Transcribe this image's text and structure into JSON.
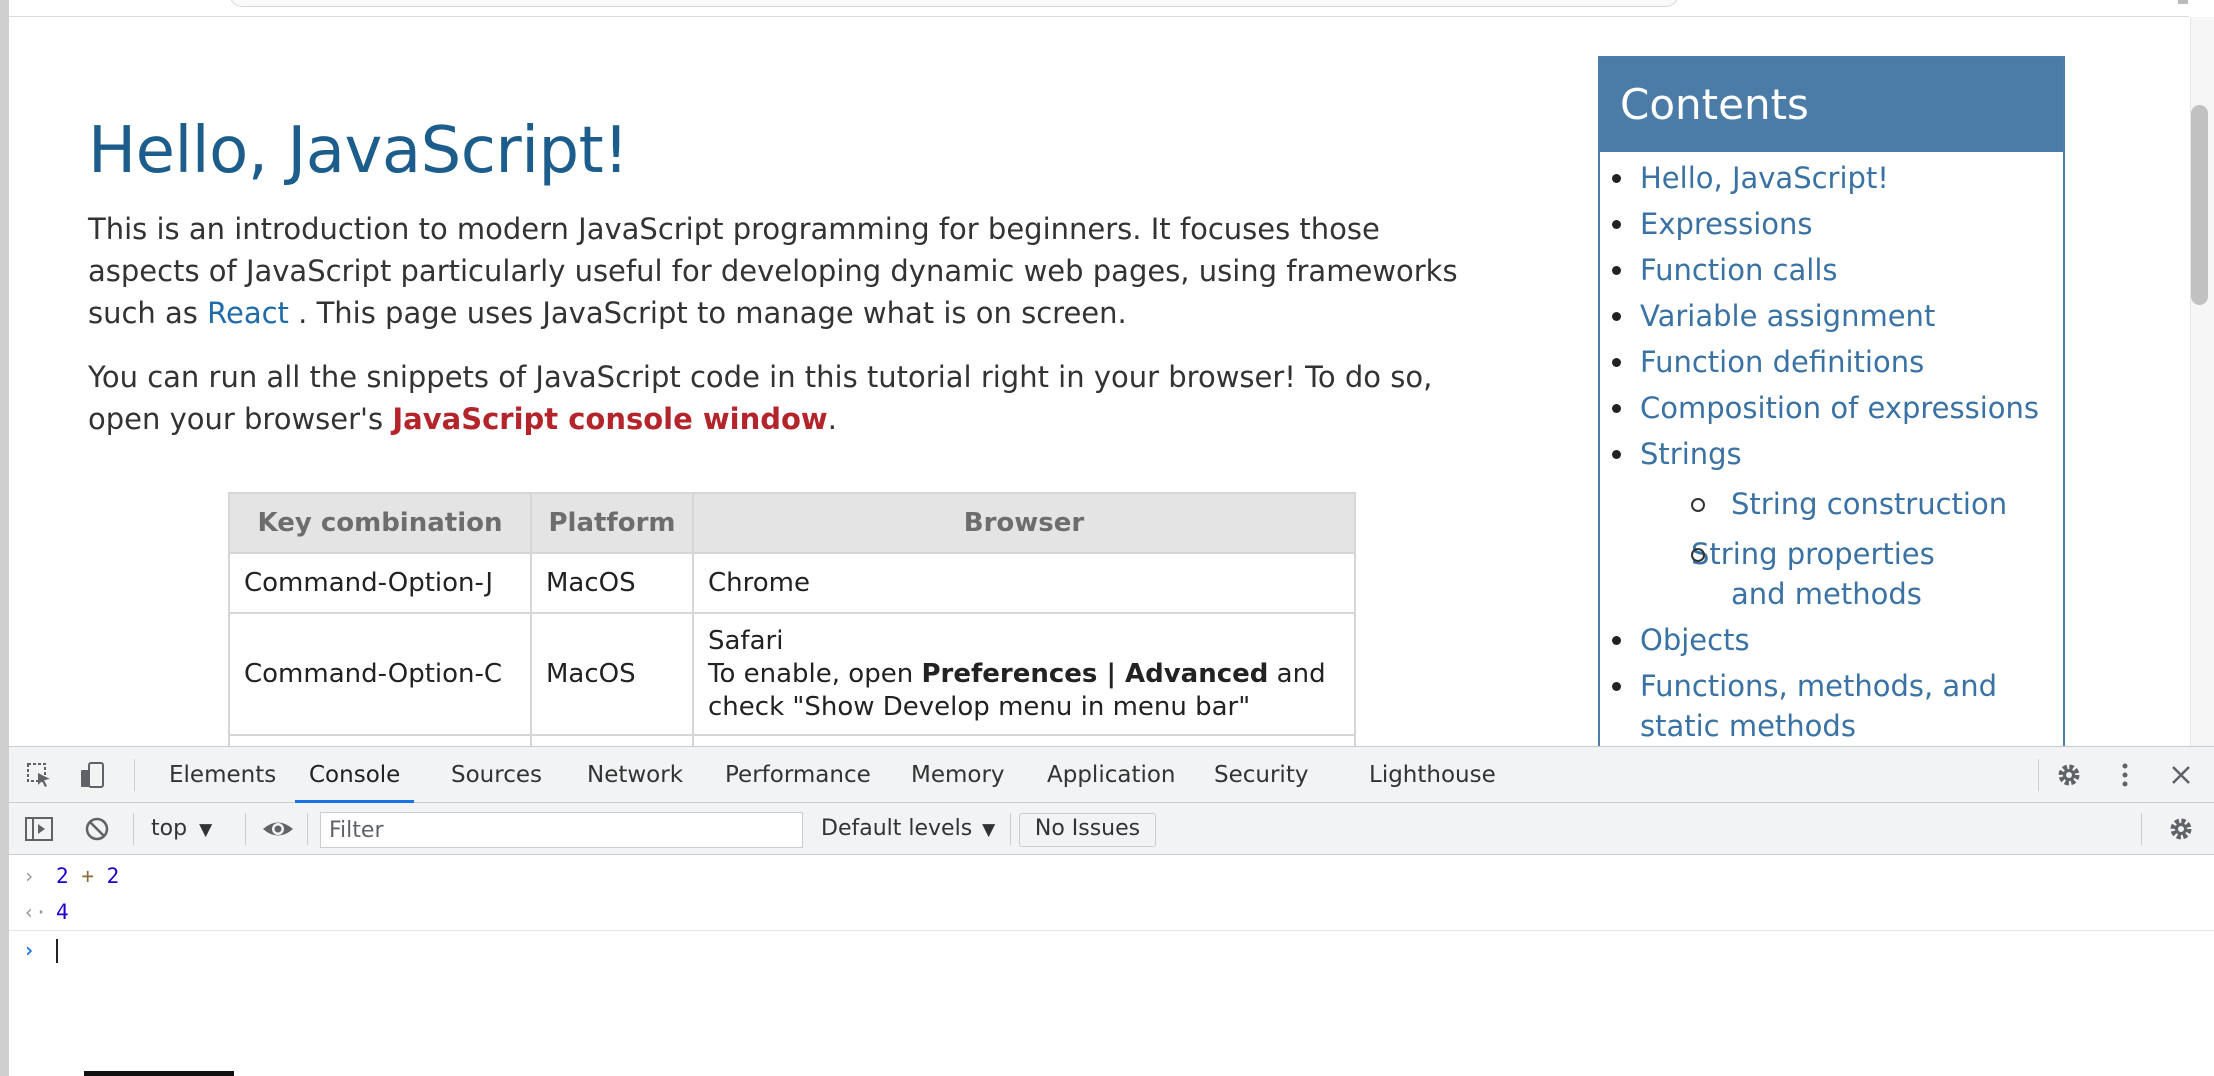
{
  "page": {
    "title": "Hello, JavaScript!",
    "intro": {
      "before_link": "This is an introduction to modern JavaScript programming for beginners. It focuses those aspects of JavaScript particularly useful for developing dynamic web pages, using frameworks such as ",
      "link": "React",
      "after_link": " . This page uses JavaScript to manage what is on screen."
    },
    "run": {
      "before": "You can run all the snippets of JavaScript code in this tutorial right in your browser! To do so, open your browser's ",
      "highlight": "JavaScript console window",
      "after": "."
    },
    "table": {
      "headers": [
        "Key combination",
        "Platform",
        "Browser"
      ],
      "rows": [
        {
          "keys": "Command-Option-J",
          "platform": "MacOS",
          "browser": "Chrome"
        },
        {
          "keys": "Command-Option-C",
          "platform": "MacOS",
          "browser_line1": "Safari",
          "browser_pre": "To enable, open ",
          "browser_bold": "Preferences | Advanced",
          "browser_post": " and check \"Show Develop menu in menu bar\""
        }
      ]
    }
  },
  "toc": {
    "heading": "Contents",
    "items": [
      "Hello, JavaScript!",
      "Expressions",
      "Function calls",
      "Variable assignment",
      "Function definitions",
      "Composition of expressions",
      "Strings",
      "Objects",
      "Functions, methods, and static methods"
    ],
    "sub_items": [
      "String construction",
      "String properties and methods"
    ]
  },
  "devtools": {
    "tabs": [
      "Elements",
      "Console",
      "Sources",
      "Network",
      "Performance",
      "Memory",
      "Application",
      "Security",
      "Lighthouse"
    ],
    "active_tab": "Console",
    "context": "top",
    "filter_placeholder": "Filter",
    "levels": "Default levels",
    "issues": "No Issues",
    "console": {
      "input_left": "2",
      "input_op": "+",
      "input_right": "2",
      "result": "4"
    }
  }
}
